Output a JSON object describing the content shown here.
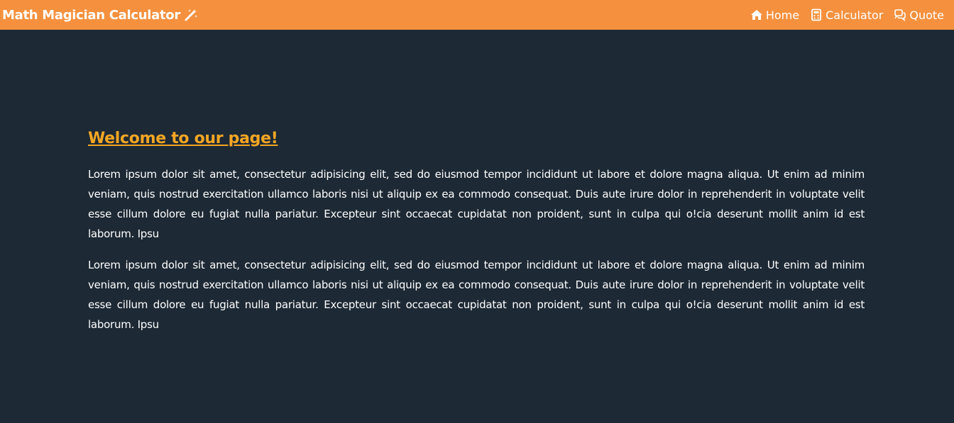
{
  "navbar": {
    "brand_label": "Math Magician Calculator",
    "brand_icon": "magic-wand-icon",
    "links": [
      {
        "label": "Home",
        "icon": "home-icon"
      },
      {
        "label": "Calculator",
        "icon": "calculator-icon"
      },
      {
        "label": "Quote",
        "icon": "chat-bubbles-icon"
      }
    ]
  },
  "main": {
    "heading": "Welcome to our page!",
    "paragraphs": [
      "Lorem ipsum dolor sit amet, consectetur adipisicing elit, sed do eiusmod tempor incididunt ut labore et dolore magna aliqua. Ut enim ad minim veniam, quis nostrud exercitation ullamco laboris nisi ut aliquip ex ea commodo consequat. Duis aute irure dolor in reprehenderit in voluptate velit esse cillum dolore eu fugiat nulla pariatur. Excepteur sint occaecat cupidatat non proident, sunt in culpa qui o!cia deserunt mollit anim id est laborum. Ipsu",
      "Lorem ipsum dolor sit amet, consectetur adipisicing elit, sed do eiusmod tempor incididunt ut labore et dolore magna aliqua. Ut enim ad minim veniam, quis nostrud exercitation ullamco laboris nisi ut aliquip ex ea commodo consequat. Duis aute irure dolor in reprehenderit in voluptate velit esse cillum dolore eu fugiat nulla pariatur. Excepteur sint occaecat cupidatat non proident, sunt in culpa qui o!cia deserunt mollit anim id est laborum. Ipsu"
    ]
  },
  "colors": {
    "navbar_bg": "#f5913e",
    "page_bg": "#1d2935",
    "heading": "#f5a623",
    "text": "#ffffff"
  }
}
